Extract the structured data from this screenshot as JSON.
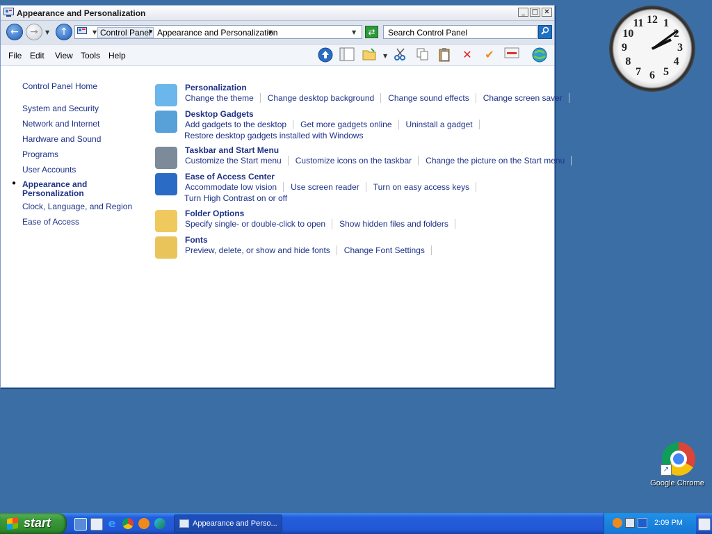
{
  "window": {
    "title": "Appearance and Personalization",
    "controls": {
      "minimize": "_",
      "maximize": "□",
      "close": "✕"
    }
  },
  "nav": {
    "address_root": "Control Panel",
    "address_current": "Appearance and Personalization",
    "search_placeholder": "Search Control Panel"
  },
  "menu": [
    "File",
    "Edit",
    "View",
    "Tools",
    "Help"
  ],
  "sidebar": {
    "home": "Control Panel Home",
    "items": [
      "System and Security",
      "Network and Internet",
      "Hardware and Sound",
      "Programs",
      "User Accounts",
      "Appearance and Personalization",
      "Clock, Language, and Region",
      "Ease of Access"
    ]
  },
  "categories": [
    {
      "title": "Personalization",
      "icon": "personalization-icon",
      "links": [
        "Change the theme",
        "Change desktop background",
        "Change sound effects",
        "Change screen saver"
      ],
      "links2": []
    },
    {
      "title": "Desktop Gadgets",
      "icon": "gadgets-icon",
      "links": [
        "Add gadgets to the desktop",
        "Get more gadgets online",
        "Uninstall a gadget"
      ],
      "links2": [
        "Restore desktop gadgets installed with Windows"
      ]
    },
    {
      "title": "Taskbar and Start Menu",
      "icon": "taskbar-icon",
      "links": [
        "Customize the Start menu",
        "Customize icons on the taskbar",
        "Change the picture on the Start menu"
      ],
      "links2": []
    },
    {
      "title": "Ease of Access Center",
      "icon": "ease-of-access-icon",
      "links": [
        "Accommodate low vision",
        "Use screen reader",
        "Turn on easy access keys"
      ],
      "links2": [
        "Turn High Contrast on or off"
      ]
    },
    {
      "title": "Folder Options",
      "icon": "folder-options-icon",
      "links": [
        "Specify single- or double-click to open",
        "Show hidden files and folders"
      ],
      "links2": []
    },
    {
      "title": "Fonts",
      "icon": "fonts-icon",
      "links": [
        "Preview, delete, or show and hide fonts",
        "Change Font Settings"
      ],
      "links2": []
    }
  ],
  "clock_gadget": {
    "numbers": [
      "12",
      "1",
      "2",
      "3",
      "4",
      "5",
      "6",
      "7",
      "8",
      "9",
      "10",
      "11"
    ],
    "hour": 2,
    "minute": 9
  },
  "desktop": {
    "chrome_label": "Google Chrome"
  },
  "taskbar": {
    "start_label": "start",
    "task_button": "Appearance and Perso...",
    "time": "2:09 PM"
  }
}
